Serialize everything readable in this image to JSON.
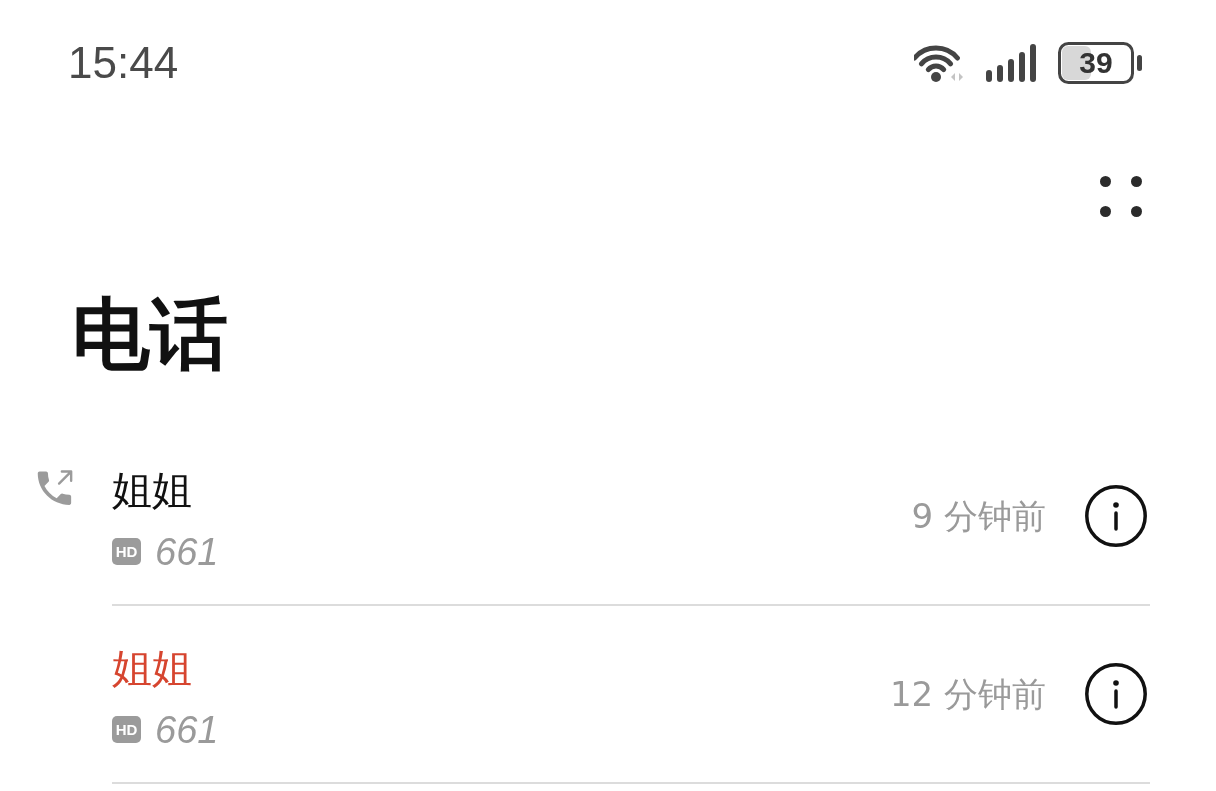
{
  "status_bar": {
    "time": "15:44",
    "battery": "39"
  },
  "header": {
    "title": "电话"
  },
  "calls": [
    {
      "kind": "outgoing",
      "name": "姐姐",
      "badge": "HD",
      "number": "661",
      "time": "9 分钟前"
    },
    {
      "kind": "missed",
      "name": "姐姐",
      "badge": "HD",
      "number": "661",
      "time": "12 分钟前"
    }
  ]
}
